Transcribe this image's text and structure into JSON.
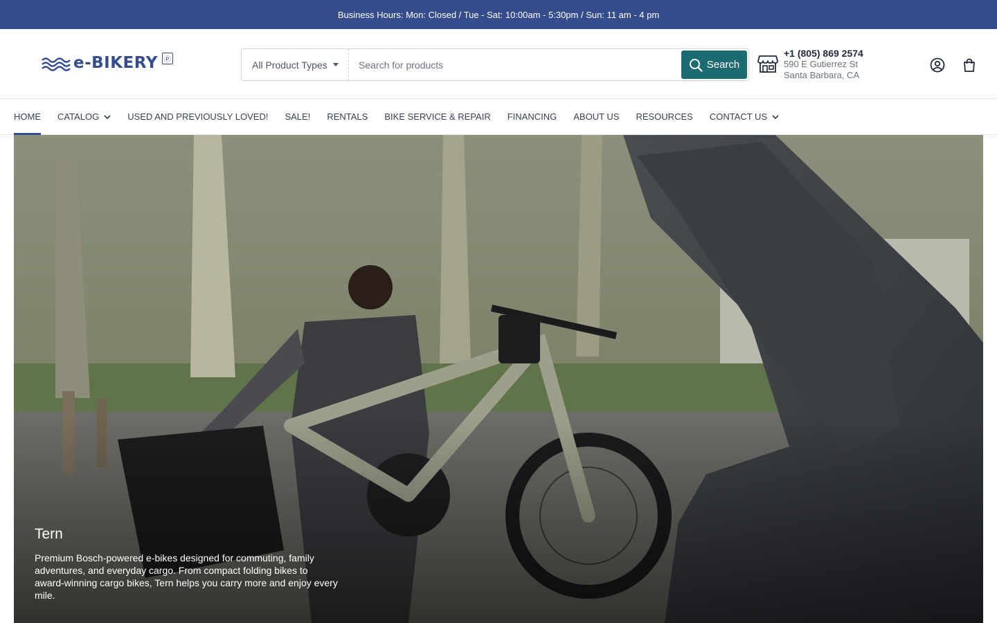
{
  "topbar": {
    "hours": "Business Hours: Mon: Closed / Tue - Sat: 10:00am - 5:30pm / Sun: 11 am - 4 pm"
  },
  "header": {
    "logo_text": "e-BIKERY",
    "search": {
      "type_label": "All Product Types",
      "placeholder": "Search for products",
      "button_label": "Search"
    },
    "store": {
      "phone": "+1 (805) 869 2574",
      "address_line1": "590 E Gutierrez St",
      "address_line2": "Santa Barbara, CA"
    }
  },
  "nav": {
    "items": [
      {
        "label": "HOME"
      },
      {
        "label": "CATALOG"
      },
      {
        "label": "USED AND PREVIOUSLY LOVED!"
      },
      {
        "label": "SALE!"
      },
      {
        "label": "RENTALS"
      },
      {
        "label": "BIKE SERVICE & REPAIR"
      },
      {
        "label": "FINANCING"
      },
      {
        "label": "ABOUT US"
      },
      {
        "label": "RESOURCES"
      },
      {
        "label": "CONTACT US"
      }
    ]
  },
  "hero": {
    "title": "Tern",
    "description": "Premium Bosch-powered e-bikes designed for commuting, family adventures, and everyday cargo. From compact folding bikes to award-winning cargo bikes, Tern helps you carry more and enjoy every mile."
  },
  "colors": {
    "brand": "#364d8d",
    "search_button": "#1c6b73"
  }
}
